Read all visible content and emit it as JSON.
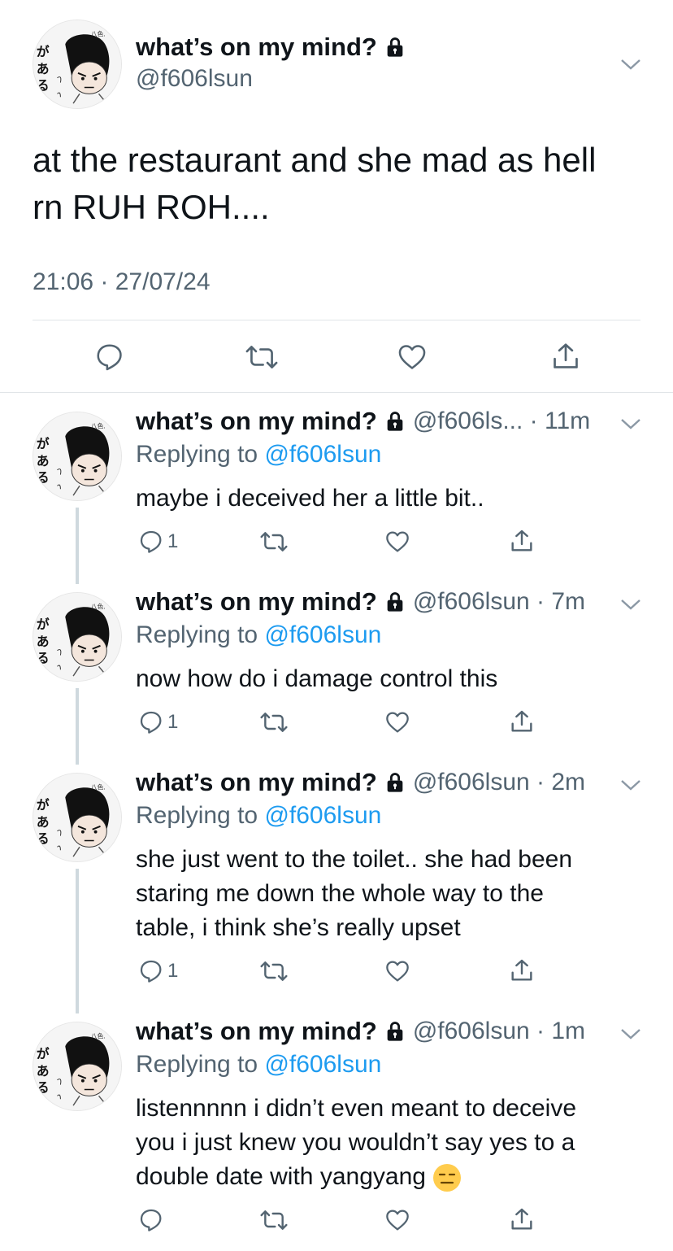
{
  "main": {
    "name": "what’s on my mind?",
    "handle": "@f606lsun",
    "text_line1": "at the restaurant and she mad as hell",
    "text_line2": "rn RUH ROH....",
    "timestamp": "21:06 · 27/07/24"
  },
  "replies": [
    {
      "name": "what’s on my mind?",
      "handle_time": "@f606ls... · 11m",
      "replying_prefix": "Replying to ",
      "replying_to": "@f606lsun",
      "lines": [
        "maybe i deceived her a little bit.."
      ],
      "reply_count": "1"
    },
    {
      "name": "what’s on my mind?",
      "handle_time": "@f606lsun · 7m",
      "replying_prefix": "Replying to ",
      "replying_to": "@f606lsun",
      "lines": [
        "now how do i damage control this"
      ],
      "reply_count": "1"
    },
    {
      "name": "what’s on my mind?",
      "handle_time": "@f606lsun · 2m",
      "replying_prefix": "Replying to ",
      "replying_to": "@f606lsun",
      "lines": [
        "she just went to the toilet.. she had been",
        "staring me down the whole way to the",
        "table, i think she’s really upset"
      ],
      "reply_count": "1"
    },
    {
      "name": "what’s on my mind?",
      "handle_time": "@f606lsun · 1m",
      "replying_prefix": "Replying to ",
      "replying_to": "@f606lsun",
      "lines": [
        "listennnnn i didn’t even meant to deceive",
        "you i just knew you wouldn’t say yes to a",
        "double date with yangyang"
      ],
      "reply_count": ""
    }
  ],
  "icons": {
    "lock": "lock-icon",
    "reply": "reply-icon",
    "retweet": "retweet-icon",
    "like": "heart-icon",
    "share": "share-icon",
    "more": "chevron-down-icon",
    "emoji": "expressionless-face-emoji"
  },
  "colors": {
    "text": "#0f1419",
    "secondary": "#536471",
    "link": "#1d9bf0",
    "divider": "#e1e5e8",
    "thread_line": "#cfd9de"
  }
}
